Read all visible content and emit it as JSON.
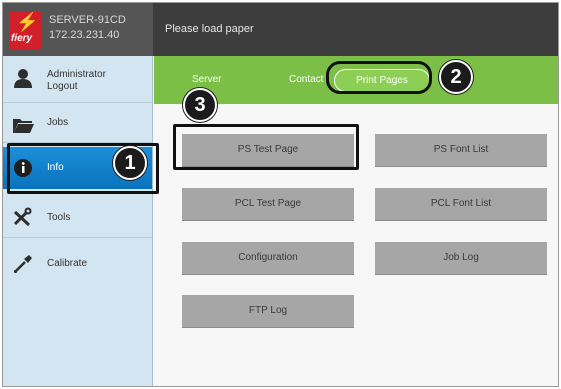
{
  "header": {
    "server_name": "SERVER-91CD",
    "server_ip": "172.23.231.40",
    "logo_text": "fiery",
    "status_message": "Please load paper"
  },
  "sidebar": {
    "items": [
      {
        "label_line1": "Administrator",
        "label_line2": "Logout",
        "icon": "user-icon"
      },
      {
        "label_line1": "Jobs",
        "icon": "folder-icon"
      },
      {
        "label_line1": "Info",
        "icon": "info-icon"
      },
      {
        "label_line1": "Tools",
        "icon": "tools-icon"
      },
      {
        "label_line1": "Calibrate",
        "icon": "eyedropper-icon"
      }
    ]
  },
  "tabs": [
    {
      "label": "Server"
    },
    {
      "label": "Contact"
    },
    {
      "label": "Print Pages",
      "active": true
    }
  ],
  "buttons": [
    {
      "label": "PS Test Page"
    },
    {
      "label": "PS Font List"
    },
    {
      "label": "PCL Test Page"
    },
    {
      "label": "PCL Font List"
    },
    {
      "label": "Configuration"
    },
    {
      "label": "Job Log"
    },
    {
      "label": "FTP Log"
    }
  ],
  "callouts": [
    "1",
    "2",
    "3"
  ],
  "colors": {
    "accent_green": "#7bbf46",
    "active_blue": "#0a73bd",
    "sidebar_bg": "#d3e5f0",
    "topbar_bg": "#3d3d3d",
    "button_gray": "#a6a6a6",
    "logo_red": "#d2202b"
  }
}
